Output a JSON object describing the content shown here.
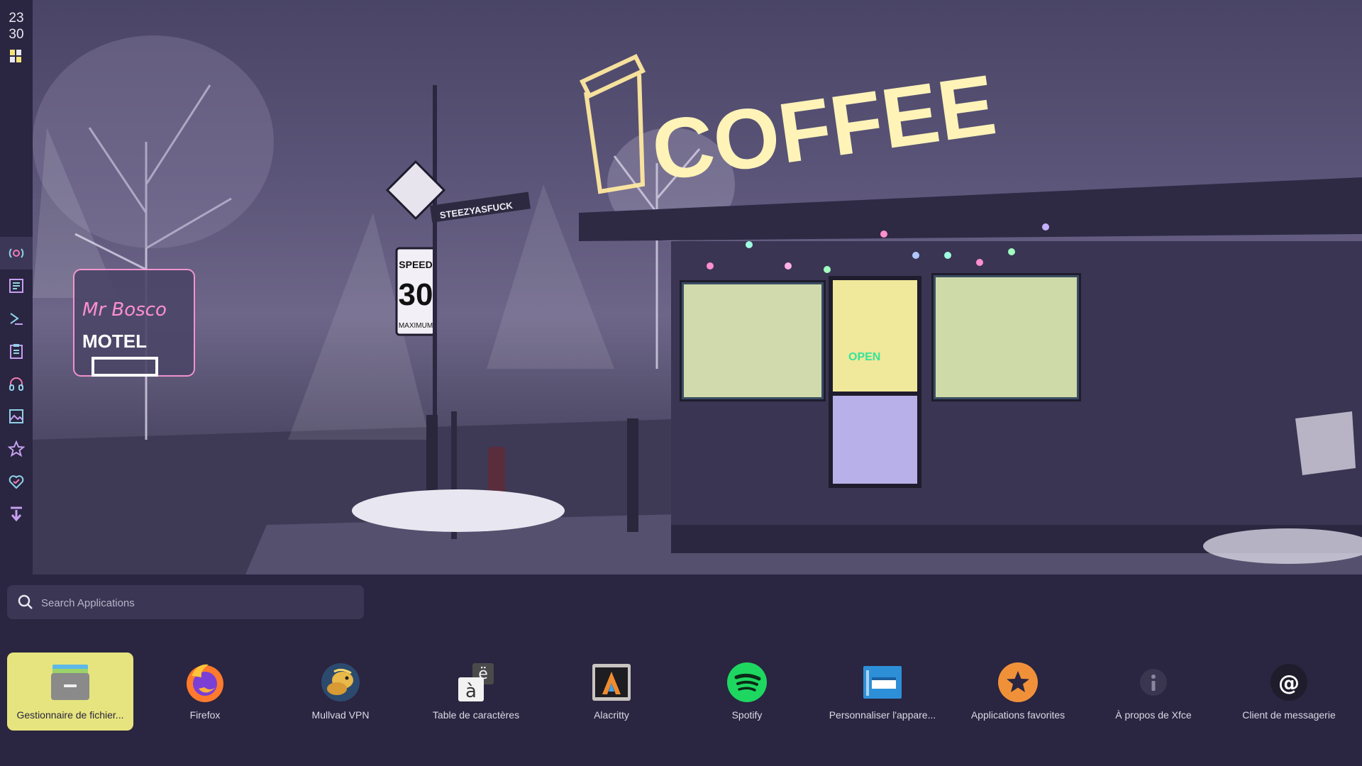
{
  "clock": {
    "hours": "23",
    "minutes": "30"
  },
  "sidebar": {
    "icons": [
      {
        "name": "radio-icon",
        "color": "#f07cb6"
      },
      {
        "name": "notes-icon",
        "color": "#c5a0f0"
      },
      {
        "name": "terminal-icon",
        "color": "#8fd3e8"
      },
      {
        "name": "clipboard-icon",
        "color": "#c5a0f0"
      },
      {
        "name": "headphones-icon",
        "color": "#f07cb6"
      },
      {
        "name": "image-icon",
        "color": "#8fd3e8"
      },
      {
        "name": "star-icon",
        "color": "#c5a0f0"
      },
      {
        "name": "heart-icon",
        "color": "#8fd3e8"
      },
      {
        "name": "download-icon",
        "color": "#c5a0f0"
      }
    ]
  },
  "search": {
    "placeholder": "Search Applications"
  },
  "apps": [
    {
      "label": "Gestionnaire de fichier...",
      "icon": "file-manager-icon"
    },
    {
      "label": "Firefox",
      "icon": "firefox-icon"
    },
    {
      "label": "Mullvad VPN",
      "icon": "mullvad-icon"
    },
    {
      "label": "Table de caractères",
      "icon": "charmap-icon"
    },
    {
      "label": "Alacritty",
      "icon": "alacritty-icon"
    },
    {
      "label": "Spotify",
      "icon": "spotify-icon"
    },
    {
      "label": "Personnaliser l'appare...",
      "icon": "appearance-icon"
    },
    {
      "label": "Applications favorites",
      "icon": "favorites-icon"
    },
    {
      "label": "À propos de Xfce",
      "icon": "info-icon"
    },
    {
      "label": "Client de messagerie",
      "icon": "mail-icon"
    }
  ],
  "wallpaper": {
    "sign_coffee": "COFFEE",
    "sign_motel": "MOTEL",
    "sign_speed_top": "SPEED",
    "sign_speed_value": "30",
    "sign_speed_bottom": "MAXIMUM",
    "sign_open": "OPEN",
    "sign_street": "STEEZYASFUCK"
  },
  "colors": {
    "accent": "#e6e47e",
    "panel": "#2a2540",
    "search_bg": "#3b3654"
  }
}
